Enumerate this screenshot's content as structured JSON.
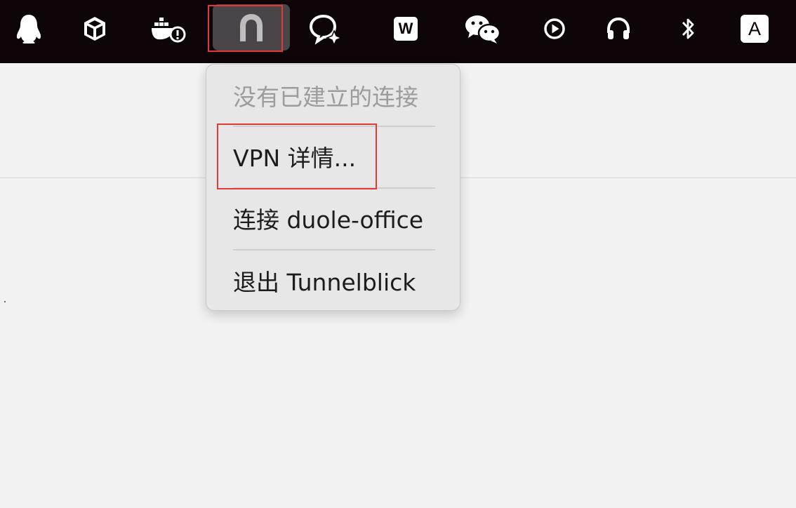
{
  "menubar": {
    "icons": [
      {
        "name": "qq-penguin-icon"
      },
      {
        "name": "package-box-icon"
      },
      {
        "name": "docker-warning-icon"
      },
      {
        "name": "tunnelblick-icon",
        "active": true
      },
      {
        "name": "chat-bot-icon"
      },
      {
        "name": "wps-icon",
        "glyph": "W"
      },
      {
        "name": "wechat-icon"
      },
      {
        "name": "play-circle-icon"
      },
      {
        "name": "headphones-icon"
      },
      {
        "name": "bluetooth-icon"
      },
      {
        "name": "input-source-icon",
        "glyph": "A"
      }
    ]
  },
  "dropdown": {
    "status_text": "没有已建立的连接",
    "items": [
      {
        "label": "VPN 详情..."
      },
      {
        "label": "连接 duole-office"
      },
      {
        "label": "退出 Tunnelblick"
      }
    ]
  },
  "colors": {
    "menubar_bg": "#0d0508",
    "highlight": "#e53935",
    "menu_bg": "#e7e7e7",
    "page_bg": "#f2f2f2"
  }
}
